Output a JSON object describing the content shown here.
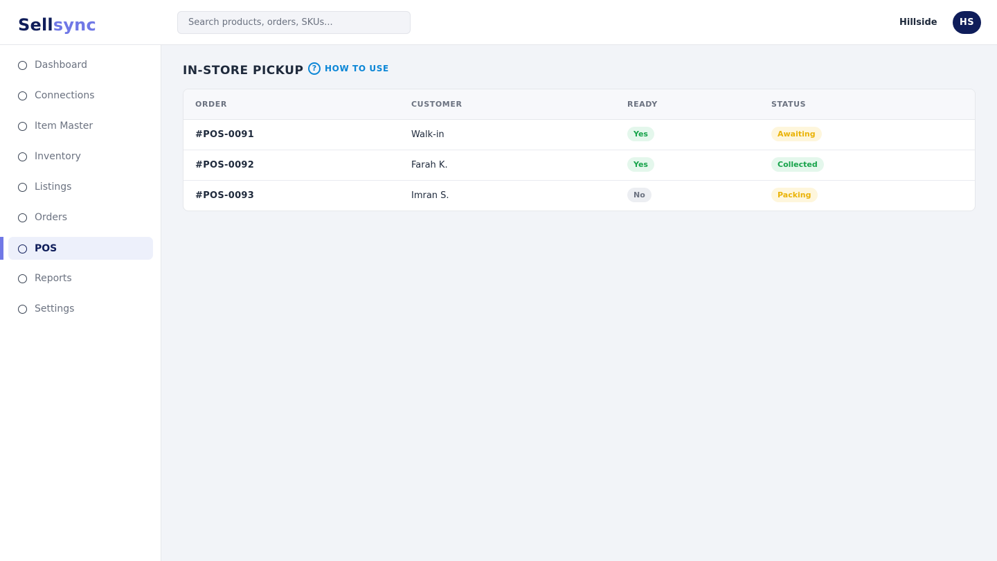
{
  "brand": {
    "part1": "Sell",
    "part2": "sync"
  },
  "search": {
    "placeholder": "Search products, orders, SKUs..."
  },
  "header": {
    "store_name": "Hillside",
    "avatar_initials": "HS"
  },
  "sidebar": {
    "items": [
      {
        "label": "Dashboard",
        "icon": "circle-icon"
      },
      {
        "label": "Connections",
        "icon": "circle-icon"
      },
      {
        "label": "Item Master",
        "icon": "circle-icon"
      },
      {
        "label": "Inventory",
        "icon": "circle-icon"
      },
      {
        "label": "Listings",
        "icon": "circle-icon"
      },
      {
        "label": "Orders",
        "icon": "circle-icon"
      },
      {
        "label": "POS",
        "icon": "circle-icon",
        "active": true
      },
      {
        "label": "Reports",
        "icon": "circle-icon"
      },
      {
        "label": "Settings",
        "icon": "circle-icon"
      }
    ]
  },
  "page": {
    "title": "IN-STORE PICKUP",
    "help_icon": "question-circle-icon",
    "help_label": "HOW TO USE"
  },
  "table": {
    "columns": [
      "ORDER",
      "CUSTOMER",
      "READY",
      "STATUS"
    ],
    "rows": [
      {
        "order": "#POS-0091",
        "customer": "Walk-in",
        "ready": "Yes",
        "status": "Awaiting"
      },
      {
        "order": "#POS-0092",
        "customer": "Farah K.",
        "ready": "Yes",
        "status": "Collected"
      },
      {
        "order": "#POS-0093",
        "customer": "Imran S.",
        "ready": "No",
        "status": "Packing"
      }
    ]
  },
  "colors": {
    "brand_dark": "#0f1d5a",
    "brand_accent": "#7078e6",
    "link": "#0b86d6",
    "badge_green": "#16a34a",
    "badge_amber": "#eab308",
    "badge_gray": "#6b7280"
  }
}
